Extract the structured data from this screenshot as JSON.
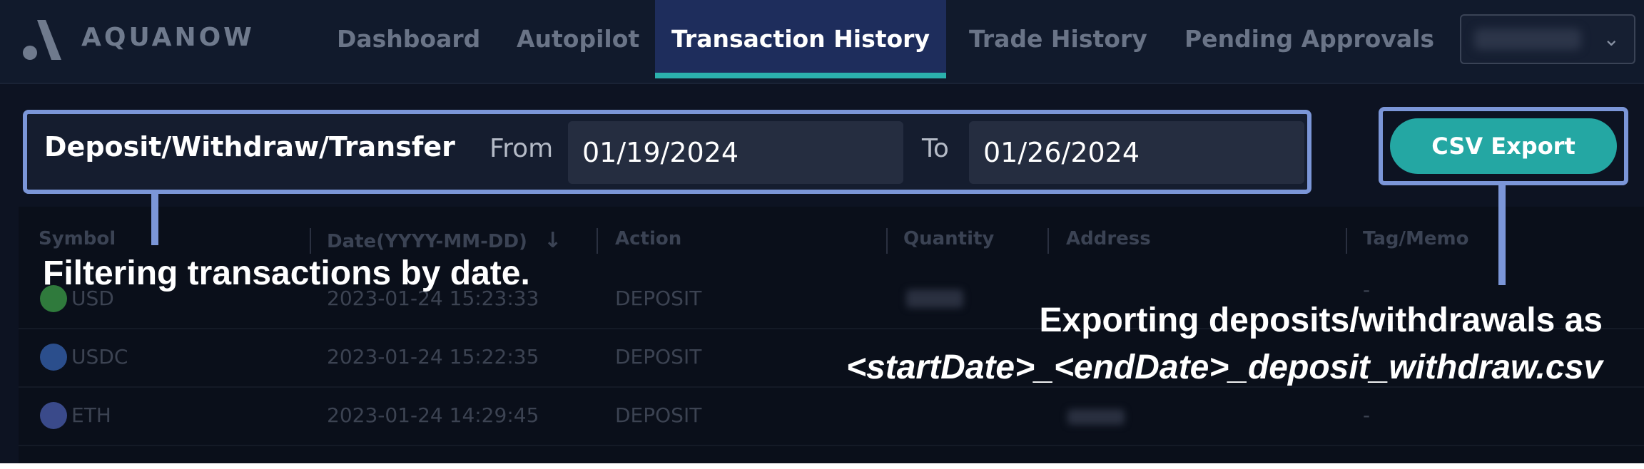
{
  "app": {
    "brand": "AQUANOW",
    "colors": {
      "accent": "#2bb1ad",
      "active_tab": "#1e2d5c",
      "callout": "#7b96d8",
      "button": "#24a7a3"
    }
  },
  "nav": {
    "tabs": [
      {
        "label": "Dashboard"
      },
      {
        "label": "Autopilot"
      },
      {
        "label": "Transaction History"
      },
      {
        "label": "Trade History"
      },
      {
        "label": "Pending Approvals"
      }
    ],
    "active_index": 2,
    "user_chevron": "⌄"
  },
  "filter": {
    "title": "Deposit/Withdraw/Transfer",
    "from_label": "From",
    "from_value": "01/19/2024",
    "to_label": "To",
    "to_value": "01/26/2024"
  },
  "export": {
    "label": "CSV Export"
  },
  "table": {
    "columns": [
      {
        "label": "Symbol"
      },
      {
        "label": "Date(YYYY-MM-DD)"
      },
      {
        "label": "Action"
      },
      {
        "label": "Quantity"
      },
      {
        "label": "Address"
      },
      {
        "label": "Tag/Memo"
      }
    ],
    "sort_icon": "↓",
    "rows": [
      {
        "symbol": "USD",
        "date": "2023-01-24 15:23:33",
        "action": "DEPOSIT",
        "tag": "-"
      },
      {
        "symbol": "USDC",
        "date": "2023-01-24 15:22:35",
        "action": "DEPOSIT",
        "tag": "-"
      },
      {
        "symbol": "ETH",
        "date": "2023-01-24 14:29:45",
        "action": "DEPOSIT",
        "tag": "-"
      }
    ]
  },
  "annotations": {
    "filter_note": "Filtering transactions by date.",
    "export_note_line1": "Exporting deposits/withdrawals as",
    "export_note_line2": "<startDate>_<endDate>_deposit_withdraw.csv"
  }
}
